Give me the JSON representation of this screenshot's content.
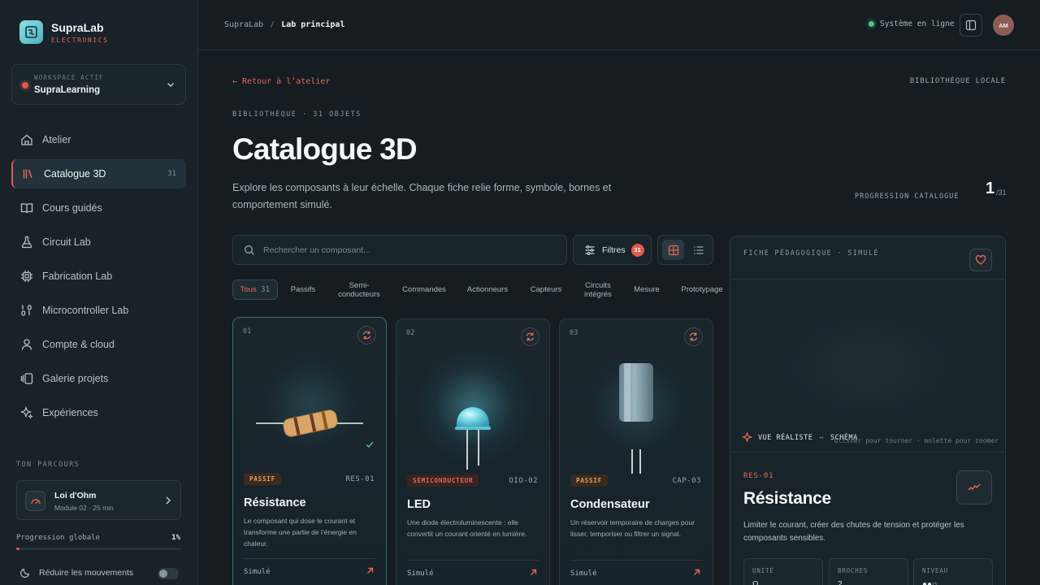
{
  "brand": {
    "name": "SupraLab",
    "subtitle": "ELECTRONICS"
  },
  "workspace": {
    "label": "WORKSPACE ACTIF",
    "name": "SupraLearning"
  },
  "nav": [
    {
      "label": "Atelier",
      "icon": "home-icon"
    },
    {
      "label": "Catalogue 3D",
      "icon": "library-icon",
      "count": "31",
      "active": true
    },
    {
      "label": "Cours guidés",
      "icon": "book-icon"
    },
    {
      "label": "Circuit Lab",
      "icon": "flask-icon"
    },
    {
      "label": "Fabrication Lab",
      "icon": "chip-icon"
    },
    {
      "label": "Microcontroller Lab",
      "icon": "binary-icon"
    },
    {
      "label": "Compte & cloud",
      "icon": "user-icon"
    },
    {
      "label": "Galerie projets",
      "icon": "gallery-icon"
    },
    {
      "label": "Expériences",
      "icon": "sparkles-icon"
    }
  ],
  "parcours": {
    "title": "TON PARCOURS",
    "lesson_title": "Loi d'Ohm",
    "lesson_meta": "Module 02 · 25 min",
    "progress_label": "Progression globale",
    "progress_value": "1%",
    "progress_fraction": 0.01
  },
  "reduce_motion": {
    "label": "Réduire les mouvements",
    "enabled": false
  },
  "topbar": {
    "breadcrumb_root": "SupraLab",
    "breadcrumb_sep": "/",
    "breadcrumb_current": "Lab principal",
    "status": "Système en ligne",
    "avatar": "AM"
  },
  "main": {
    "back_link": "← Retour à l’atelier",
    "lib_local": "BIBLIOTHÈQUE LOCALE",
    "overline": "BIBLIOTHÈQUE · 31 OBJETS",
    "title": "Catalogue 3D",
    "description": "Explore les composants à leur échelle. Chaque fiche relie forme, symbole, bornes et comportement simulé.",
    "progress_label": "PROGRESSION CATALOGUE",
    "progress_num": "1",
    "progress_total": "/31"
  },
  "search": {
    "placeholder": "Rechercher un composant..."
  },
  "filters": {
    "label": "Filtres",
    "badge": "31"
  },
  "chips": [
    {
      "label": "Tous",
      "count": "31"
    },
    {
      "label": "Passifs"
    },
    {
      "label": "Semi-\nconducteurs"
    },
    {
      "label": "Commandes"
    },
    {
      "label": "Actionneurs"
    },
    {
      "label": "Capteurs"
    },
    {
      "label": "Circuits\nintégrés"
    },
    {
      "label": "Mesure"
    },
    {
      "label": "Prototypage"
    }
  ],
  "cards": [
    {
      "num": "01",
      "tag": "PASSIF",
      "code": "RES-01",
      "title": "Résistance",
      "desc": "Le composant qui dose le courant et transforme une partie de l’énergie en chaleur.",
      "foot": "Simulé"
    },
    {
      "num": "02",
      "tag": "SEMICONDUCTEUR",
      "code": "DIO-02",
      "title": "LED",
      "desc": "Une diode électroluminescente : elle convertit un courant orienté en lumière.",
      "foot": "Simulé"
    },
    {
      "num": "03",
      "tag": "PASSIF",
      "code": "CAP-03",
      "title": "Condensateur",
      "desc": "Un réservoir temporaire de charges pour lisser, temporiser ou filtrer un signal.",
      "foot": "Simulé"
    }
  ],
  "detail": {
    "header": "FICHE PÉDAGOGIQUE · SIMULÉ",
    "view_real": "VUE RÉALISTE",
    "view_sep": "↔",
    "view_schema": "SCHÉMA",
    "hint": "Glisser pour tourner · molette pour zoomer",
    "code": "RES-01",
    "title": "Résistance",
    "description": "Limiter le courant, créer des chutes de tension et protéger les composants sensibles.",
    "stats": [
      {
        "label": "UNITÉ",
        "value": "Ω"
      },
      {
        "label": "BROCHES",
        "value": "2"
      },
      {
        "label": "NIVEAU",
        "value": "●●○"
      }
    ]
  },
  "colors": {
    "accent": "#e05a4c",
    "online": "#46c98a",
    "brand": "#8de0e6"
  }
}
